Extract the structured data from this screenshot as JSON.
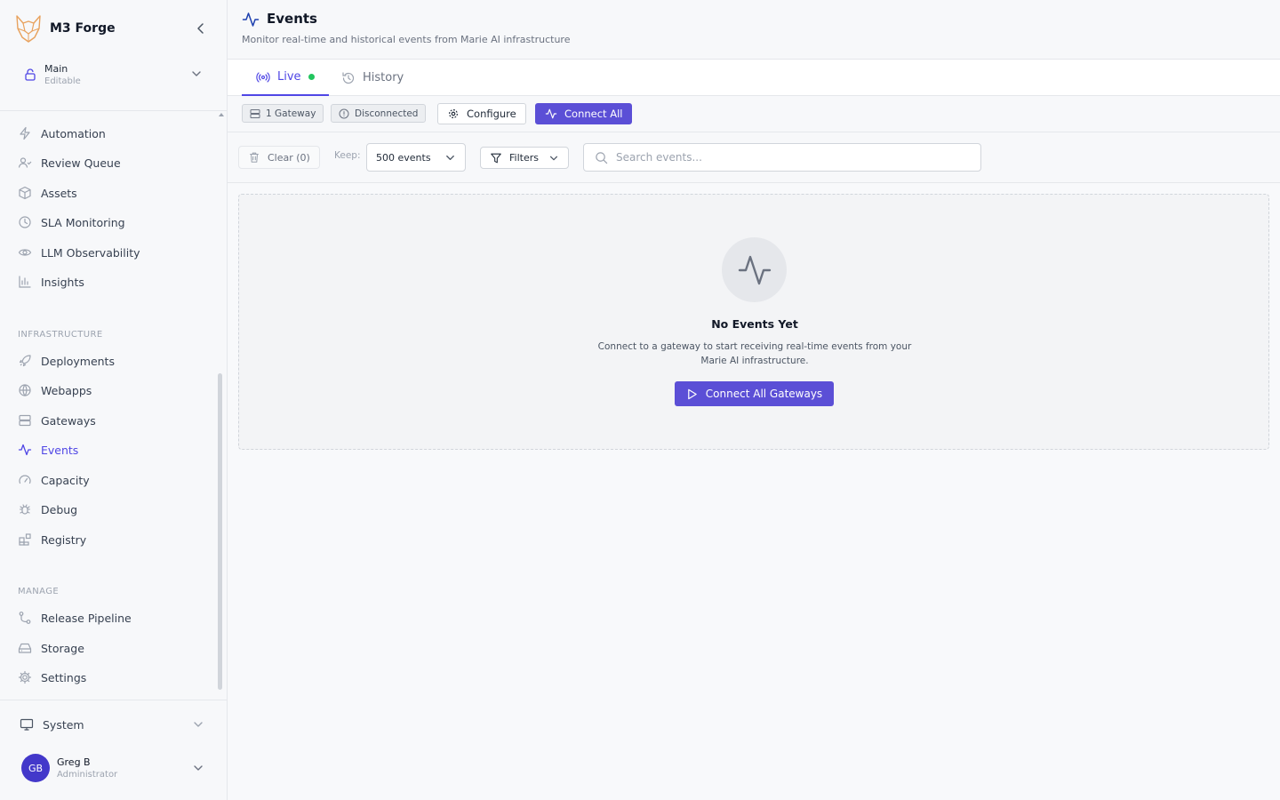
{
  "brand": {
    "name": "M3 Forge"
  },
  "workspace": {
    "name": "Main",
    "mode": "Editable"
  },
  "nav": {
    "top": [
      {
        "label": "Automation",
        "icon": "zap-icon"
      },
      {
        "label": "Review Queue",
        "icon": "users-icon"
      },
      {
        "label": "Assets",
        "icon": "box-icon"
      },
      {
        "label": "SLA Monitoring",
        "icon": "clock-icon"
      },
      {
        "label": "LLM Observability",
        "icon": "eye-icon"
      },
      {
        "label": "Insights",
        "icon": "bar-chart-icon"
      }
    ],
    "infrastructure_label": "INFRASTRUCTURE",
    "infrastructure": [
      {
        "label": "Deployments",
        "icon": "rocket-icon"
      },
      {
        "label": "Webapps",
        "icon": "globe-icon"
      },
      {
        "label": "Gateways",
        "icon": "server-icon"
      },
      {
        "label": "Events",
        "icon": "activity-icon",
        "active": true
      },
      {
        "label": "Capacity",
        "icon": "gauge-icon"
      },
      {
        "label": "Debug",
        "icon": "bug-icon"
      },
      {
        "label": "Registry",
        "icon": "blocks-icon"
      }
    ],
    "manage_label": "MANAGE",
    "manage": [
      {
        "label": "Release Pipeline",
        "icon": "git-branch-icon"
      },
      {
        "label": "Storage",
        "icon": "hard-drive-icon"
      },
      {
        "label": "Settings",
        "icon": "gear-icon"
      }
    ]
  },
  "system": {
    "label": "System"
  },
  "user": {
    "initials": "GB",
    "name": "Greg B",
    "role": "Administrator"
  },
  "page": {
    "title": "Events",
    "subtitle": "Monitor real-time and historical events from Marie AI infrastructure"
  },
  "tabs": [
    {
      "label": "Live",
      "active": true
    },
    {
      "label": "History",
      "active": false
    }
  ],
  "status": {
    "gateway_count": "1 Gateway",
    "connection": "Disconnected",
    "configure_label": "Configure",
    "connect_all_label": "Connect All"
  },
  "controls": {
    "clear_label": "Clear (0)",
    "keep_label": "Keep:",
    "keep_value": "500 events",
    "filters_label": "Filters",
    "search_placeholder": "Search events..."
  },
  "empty_state": {
    "title": "No Events Yet",
    "description": "Connect to a gateway to start receiving real-time events from your Marie AI infrastructure.",
    "button_label": "Connect All Gateways"
  },
  "colors": {
    "accent": "#5b4fd6",
    "active_text": "#4f46e5",
    "live_dot": "#22c55e",
    "avatar": "#4338ca"
  }
}
